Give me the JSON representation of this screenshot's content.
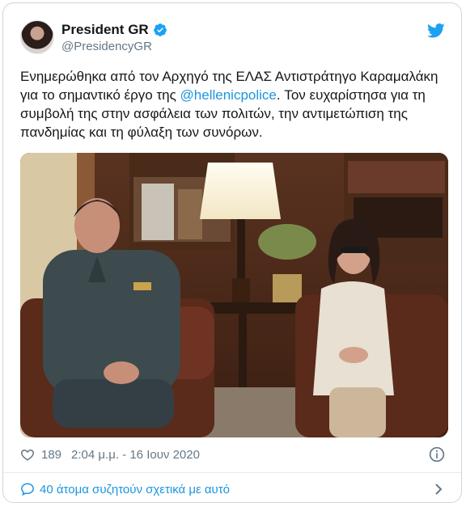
{
  "author": {
    "name": "President GR",
    "handle": "@PresidencyGR",
    "verified": true
  },
  "tweet": {
    "text_before": "Ενημερώθηκα από τον Αρχηγό της ΕΛΑΣ Αντιστράτηγο Καραμαλάκη για το σημαντικό έργο της ",
    "mention": "@hellenicpolice",
    "text_after": ". Τον ευχαρίστησα για τη συμβολή της στην ασφάλεια των πολιτών, την αντιμετώπιση της πανδημίας και τη φύλαξη των συνόρων."
  },
  "stats": {
    "likes": "189",
    "timestamp": "2:04 μ.μ. - 16 Ιουν 2020"
  },
  "footer": {
    "discussion": "40 άτομα συζητούν σχετικά με αυτό"
  },
  "colors": {
    "link": "#1b95e0",
    "twitter_blue": "#1da1f2",
    "muted": "#657786"
  },
  "icons": [
    "verified-badge-icon",
    "twitter-bird-icon",
    "heart-icon",
    "info-icon",
    "speech-bubble-icon",
    "chevron-right-icon"
  ]
}
